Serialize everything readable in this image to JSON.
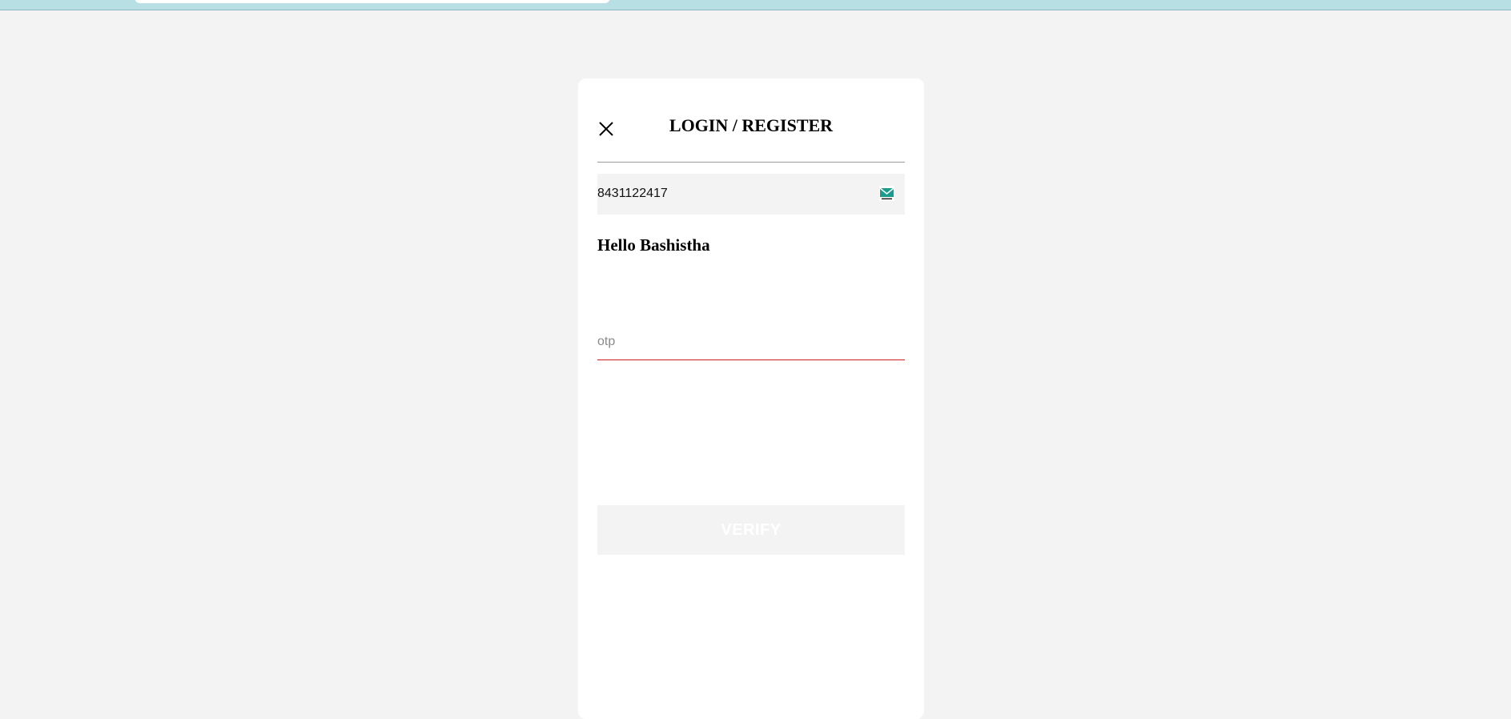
{
  "modal": {
    "title": "LOGIN / REGISTER",
    "phone_value": "8431122417",
    "greeting": "Hello Bashistha",
    "otp_placeholder": "otp",
    "verify_label": "VERIFY"
  },
  "icons": {
    "close": "close-icon",
    "mail": "mail-icon"
  },
  "colors": {
    "top_strip": "#b8dfe3",
    "otp_underline": "#d31d1d",
    "mail_icon": "#1a9c8c",
    "verify_bg": "#f3f3f3"
  }
}
